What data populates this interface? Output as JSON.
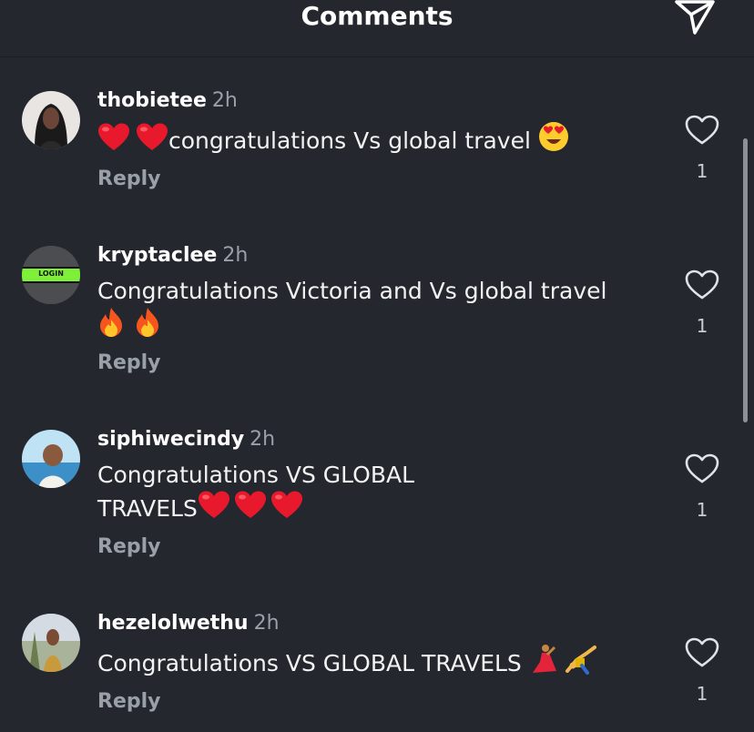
{
  "header": {
    "title": "Comments",
    "send_icon": "send-icon"
  },
  "comments": [
    {
      "user": "thobietee",
      "time": "2h",
      "text_parts": [
        "",
        "congratulations Vs global travel "
      ],
      "reply": "Reply",
      "likes": "1"
    },
    {
      "user": "kryptaclee",
      "time": "2h",
      "avatar_label": "LOGIN",
      "text_parts": [
        "Congratulations Victoria and Vs global travel"
      ],
      "reply": "Reply",
      "likes": "1"
    },
    {
      "user": "siphiwecindy",
      "time": "2h",
      "text_parts": [
        "Congratulations VS GLOBAL",
        "TRAVELS"
      ],
      "reply": "Reply",
      "likes": "1"
    },
    {
      "user": "hezelolwethu",
      "time": "2h",
      "text_parts": [
        "Congratulations VS GLOBAL TRAVELS "
      ],
      "reply": "Reply",
      "likes": "1"
    }
  ],
  "colors": {
    "background": "#24272e",
    "muted": "#9aa0a8",
    "heart_red": "#e8192c"
  }
}
